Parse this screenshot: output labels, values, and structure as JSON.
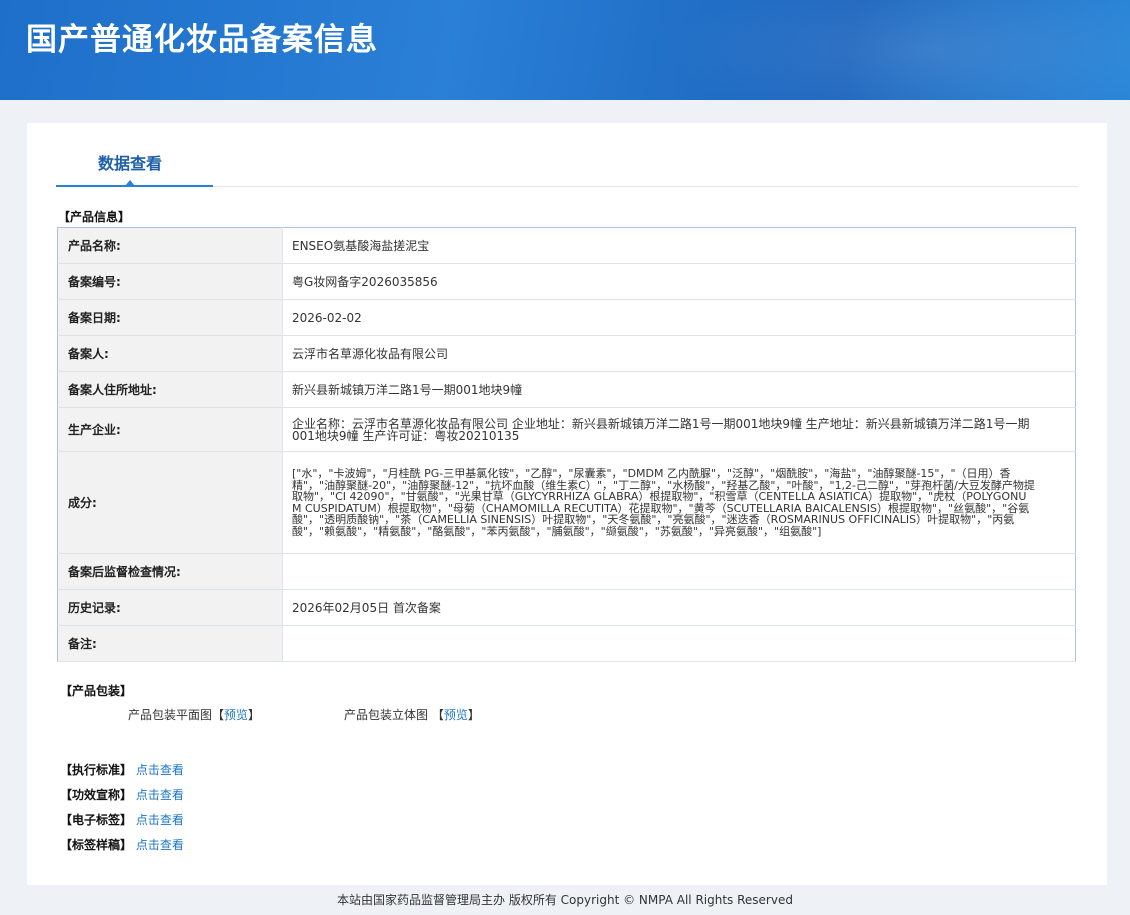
{
  "header": {
    "title": "国产普通化妆品备案信息"
  },
  "tabs": [
    {
      "label": "数据查看"
    }
  ],
  "product_info": {
    "section_title": "【产品信息】",
    "rows": [
      {
        "key": "产品名称:",
        "value": "ENSEO氨基酸海盐搓泥宝"
      },
      {
        "key": "备案编号:",
        "value": "粤G妆网备字2026035856"
      },
      {
        "key": "备案日期:",
        "value": "2026-02-02"
      },
      {
        "key": "备案人:",
        "value": "云浮市名草源化妆品有限公司"
      },
      {
        "key": "备案人住所地址:",
        "value": "新兴县新城镇万洋二路1号一期001地块9幢"
      },
      {
        "key": "生产企业:",
        "value": "企业名称：云浮市名草源化妆品有限公司 企业地址：新兴县新城镇万洋二路1号一期001地块9幢 生产地址：新兴县新城镇万洋二路1号一期001地块9幢 生产许可证：粤妆20210135"
      },
      {
        "key": "成分:",
        "value": "[\"水\"，\"卡波姆\"，\"月桂酰 PG-三甲基氯化铵\"，\"乙醇\"，\"尿囊素\"，\"DMDM 乙内酰脲\"，\"泛醇\"，\"烟酰胺\"，\"海盐\"，\"油醇聚醚-15\"，\"（日用）香精\"，\"油醇聚醚-20\"，\"油醇聚醚-12\"，\"抗坏血酸（维生素C）\"，\"丁二醇\"，\"水杨酸\"，\"羟基乙酸\"，\"叶酸\"，\"1,2-己二醇\"，\"芽孢杆菌/大豆发酵产物提取物\"，\"CI 42090\"，\"甘氨酸\"，\"光果甘草（GLYCYRRHIZA GLABRA）根提取物\"，\"积雪草（CENTELLA ASIATICA）提取物\"，\"虎杖（POLYGONUM CUSPIDATUM）根提取物\"，\"母菊（CHAMOMILLA RECUTITA）花提取物\"，\"黄芩（SCUTELLARIA BAICALENSIS）根提取物\"，\"丝氨酸\"，\"谷氨酸\"，\"透明质酸钠\"，\"茶（CAMELLIA SINENSIS）叶提取物\"，\"天冬氨酸\"，\"亮氨酸\"，\"迷迭香（ROSMARINUS OFFICINALIS）叶提取物\"，\"丙氨酸\"，\"赖氨酸\"，\"精氨酸\"，\"酪氨酸\"，\"苯丙氨酸\"，\"脯氨酸\"，\"缬氨酸\"，\"苏氨酸\"，\"异亮氨酸\"，\"组氨酸\"]"
      },
      {
        "key": "备案后监督检查情况:",
        "value": ""
      },
      {
        "key": "历史记录:",
        "value": "2026年02月05日 首次备案"
      },
      {
        "key": "备注:",
        "value": ""
      }
    ]
  },
  "packaging": {
    "section_title": "【产品包装】",
    "flat_label": "产品包装平面图",
    "solid_label": "产品包装立体图",
    "bracket_open": "【",
    "bracket_close": "】",
    "preview_link": "预览"
  },
  "standards": [
    {
      "label": "【执行标准】",
      "link": "点击查看"
    },
    {
      "label": "【功效宣称】",
      "link": "点击查看"
    },
    {
      "label": "【电子标签】",
      "link": "点击查看"
    },
    {
      "label": "【标签样稿】",
      "link": "点击查看"
    }
  ],
  "footer": {
    "text": "本站由国家药品监督管理局主办 版权所有 Copyright © NMPA All Rights Reserved"
  }
}
